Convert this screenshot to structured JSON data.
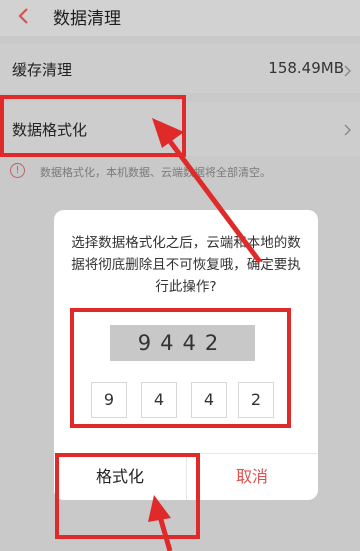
{
  "header": {
    "title": "数据清理"
  },
  "rows": {
    "cache": {
      "label": "缓存清理",
      "value": "158.49MB"
    },
    "format": {
      "label": "数据格式化"
    }
  },
  "hint": {
    "text": "数据格式化，本机数据、云端数据将全部清空。"
  },
  "dialog": {
    "message": "选择数据格式化之后，云端和本地的数据将彻底删除且不可恢复哦，确定要执行此操作?",
    "code": "9442",
    "inputs": [
      "9",
      "4",
      "4",
      "2"
    ],
    "confirm_label": "格式化",
    "cancel_label": "取消"
  },
  "colors": {
    "annotation": "#e02a2a",
    "cancel": "#e05050"
  }
}
